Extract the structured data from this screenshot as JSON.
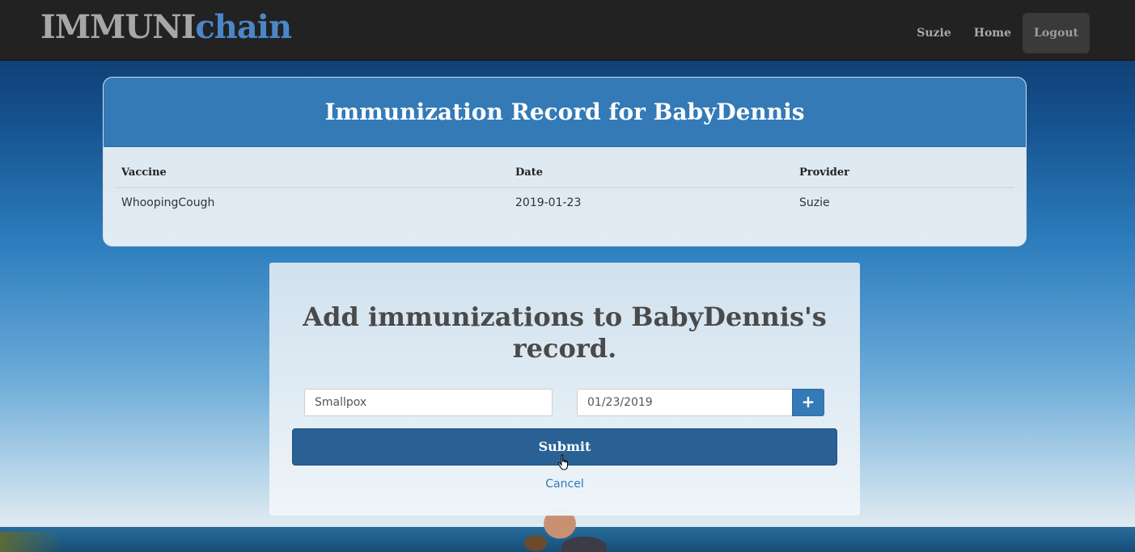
{
  "navbar": {
    "brand_part1": "IMMUNI",
    "brand_part2": "chain",
    "links": [
      {
        "label": "Suzie"
      },
      {
        "label": "Home"
      },
      {
        "label": "Logout"
      }
    ]
  },
  "record": {
    "title": "Immunization Record for BabyDennis",
    "columns": [
      "Vaccine",
      "Date",
      "Provider"
    ],
    "rows": [
      {
        "vaccine": "WhoopingCough",
        "date": "2019-01-23",
        "provider": "Suzie"
      }
    ]
  },
  "add_form": {
    "title": "Add immunizations to BabyDennis's record.",
    "vaccine_value": "Smallpox",
    "date_value": "01/23/2019",
    "add_row_icon": "plus-icon",
    "submit_label": "Submit",
    "cancel_label": "Cancel"
  },
  "colors": {
    "navbar_bg": "#222222",
    "brand_gray": "#a7a7a7",
    "brand_blue": "#4b86c9",
    "primary": "#337ab7",
    "submit": "#2a6195"
  }
}
